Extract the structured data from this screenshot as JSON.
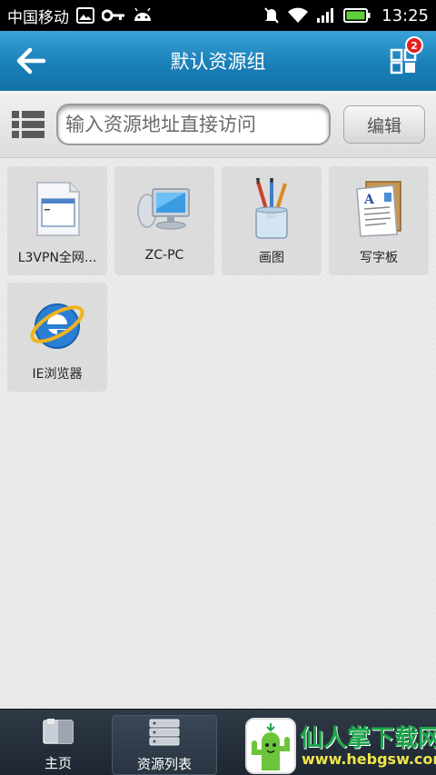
{
  "status_bar": {
    "carrier": "中国移动",
    "time": "13:25",
    "icons": [
      "image-icon",
      "key-icon",
      "android-icon",
      "mute-icon",
      "wifi-icon",
      "signal-icon",
      "battery-icon"
    ]
  },
  "header": {
    "title": "默认资源组",
    "badge_count": "2",
    "accent": "#1a7fb8"
  },
  "search": {
    "placeholder": "输入资源地址直接访问",
    "value": "",
    "edit_label": "编辑"
  },
  "resources": [
    {
      "label": "L3VPN全网...",
      "icon": "app-window-icon"
    },
    {
      "label": "ZC-PC",
      "icon": "computer-icon"
    },
    {
      "label": "画图",
      "icon": "paint-brushes-icon"
    },
    {
      "label": "写字板",
      "icon": "wordpad-icon"
    },
    {
      "label": "IE浏览器",
      "icon": "ie-browser-icon"
    }
  ],
  "bottom_nav": {
    "items": [
      {
        "label": "主页",
        "icon": "home-book-icon"
      },
      {
        "label": "资源列表",
        "icon": "server-list-icon",
        "active": true
      }
    ]
  },
  "watermark": {
    "title": "仙人掌下载网",
    "url": "www.hebgsw.com"
  }
}
